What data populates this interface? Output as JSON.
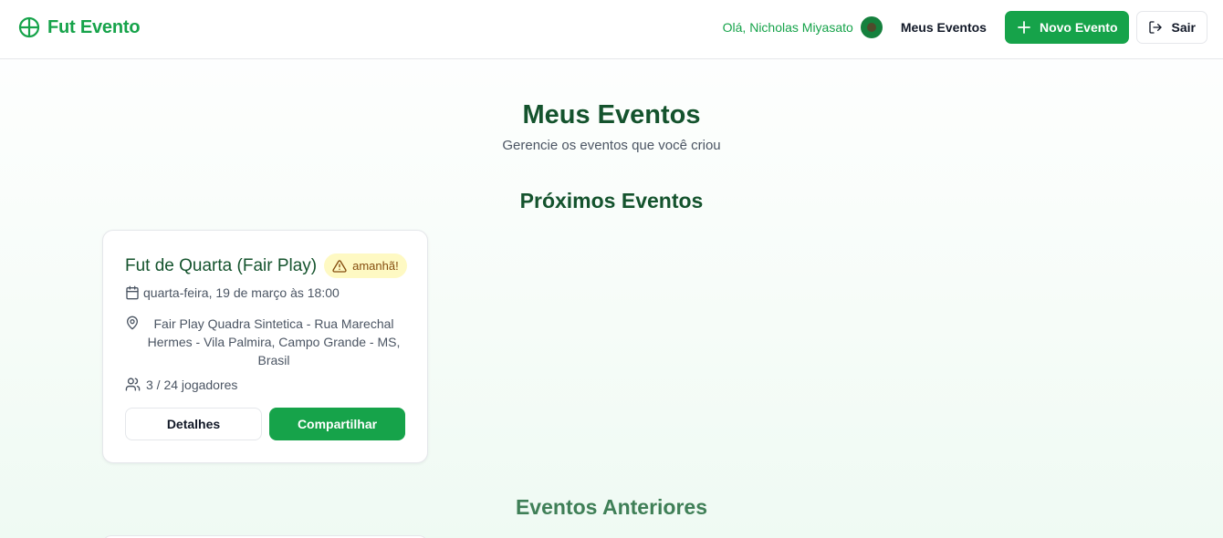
{
  "brand": {
    "name": "Fut Evento",
    "accent": "#16a34a"
  },
  "header": {
    "greeting": "Olá, Nicholas Miyasato",
    "nav_my_events": "Meus Eventos",
    "new_event_label": "Novo Evento",
    "logout_label": "Sair"
  },
  "main": {
    "title": "Meus Eventos",
    "subtitle": "Gerencie os eventos que você criou",
    "upcoming_title": "Próximos Eventos",
    "past_title": "Eventos Anteriores"
  },
  "upcoming_events": [
    {
      "title": "Fut de Quarta (Fair Play)",
      "badge": "amanhã!",
      "datetime": "quarta-feira, 19 de março às 18:00",
      "location": "Fair Play Quadra Sintetica - Rua Marechal Hermes - Vila Palmira, Campo Grande - MS, Brasil",
      "players": "3 / 24 jogadores",
      "details_label": "Detalhes",
      "share_label": "Compartilhar"
    }
  ],
  "icons": {
    "logo": "circle-cross-icon",
    "new": "plus-icon",
    "logout": "logout-icon",
    "warning": "warning-triangle-icon",
    "date": "calendar-icon",
    "location": "map-pin-icon",
    "players": "users-icon"
  },
  "colors": {
    "primary": "#16a34a",
    "heading": "#14532d",
    "badge_bg": "#fef9c3",
    "badge_text": "#854d0e"
  }
}
